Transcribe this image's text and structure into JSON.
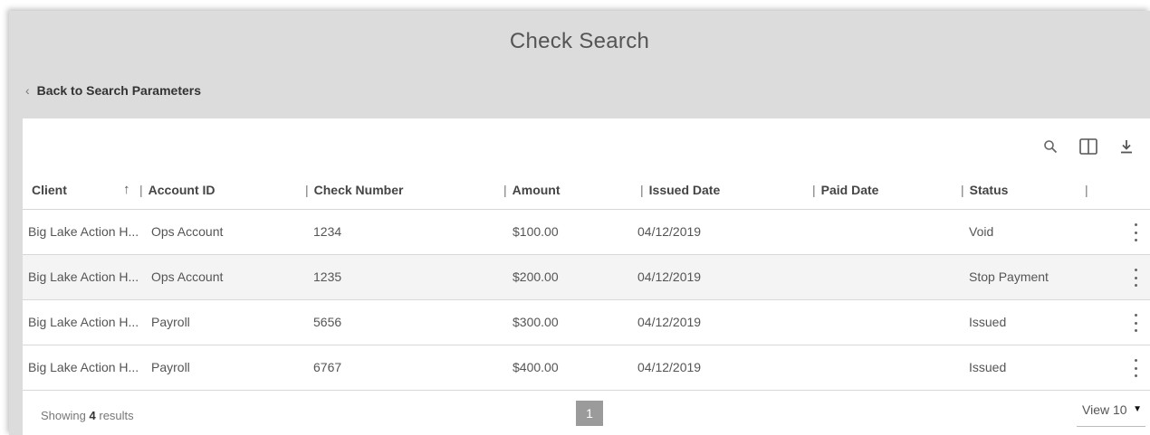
{
  "page": {
    "title": "Check Search",
    "back_label": "Back to Search Parameters"
  },
  "toolbar": {
    "icons": [
      "search-icon",
      "columns-icon",
      "download-icon"
    ]
  },
  "table": {
    "columns": [
      "Client",
      "Account ID",
      "Check Number",
      "Amount",
      "Issued Date",
      "Paid Date",
      "Status"
    ],
    "sort": {
      "column": "Client",
      "direction": "ascending"
    },
    "rows": [
      {
        "client": "Big Lake Action H...",
        "account_id": "Ops Account",
        "check_number": "1234",
        "amount": "$100.00",
        "issued_date": "04/12/2019",
        "paid_date": "",
        "status": "Void"
      },
      {
        "client": "Big Lake Action H...",
        "account_id": "Ops Account",
        "check_number": "1235",
        "amount": "$200.00",
        "issued_date": "04/12/2019",
        "paid_date": "",
        "status": "Stop Payment"
      },
      {
        "client": "Big Lake Action H...",
        "account_id": "Payroll",
        "check_number": "5656",
        "amount": "$300.00",
        "issued_date": "04/12/2019",
        "paid_date": "",
        "status": "Issued"
      },
      {
        "client": "Big Lake Action H...",
        "account_id": "Payroll",
        "check_number": "6767",
        "amount": "$400.00",
        "issued_date": "04/12/2019",
        "paid_date": "",
        "status": "Issued"
      }
    ]
  },
  "footer": {
    "showing_prefix": "Showing",
    "result_count": "4",
    "showing_suffix": "results",
    "current_page": "1",
    "view_label": "View 10"
  },
  "colors": {
    "background": "#dcdcdc",
    "card": "#ffffff",
    "row_alt": "#f4f4f4",
    "page_button": "#9b9b9b"
  }
}
